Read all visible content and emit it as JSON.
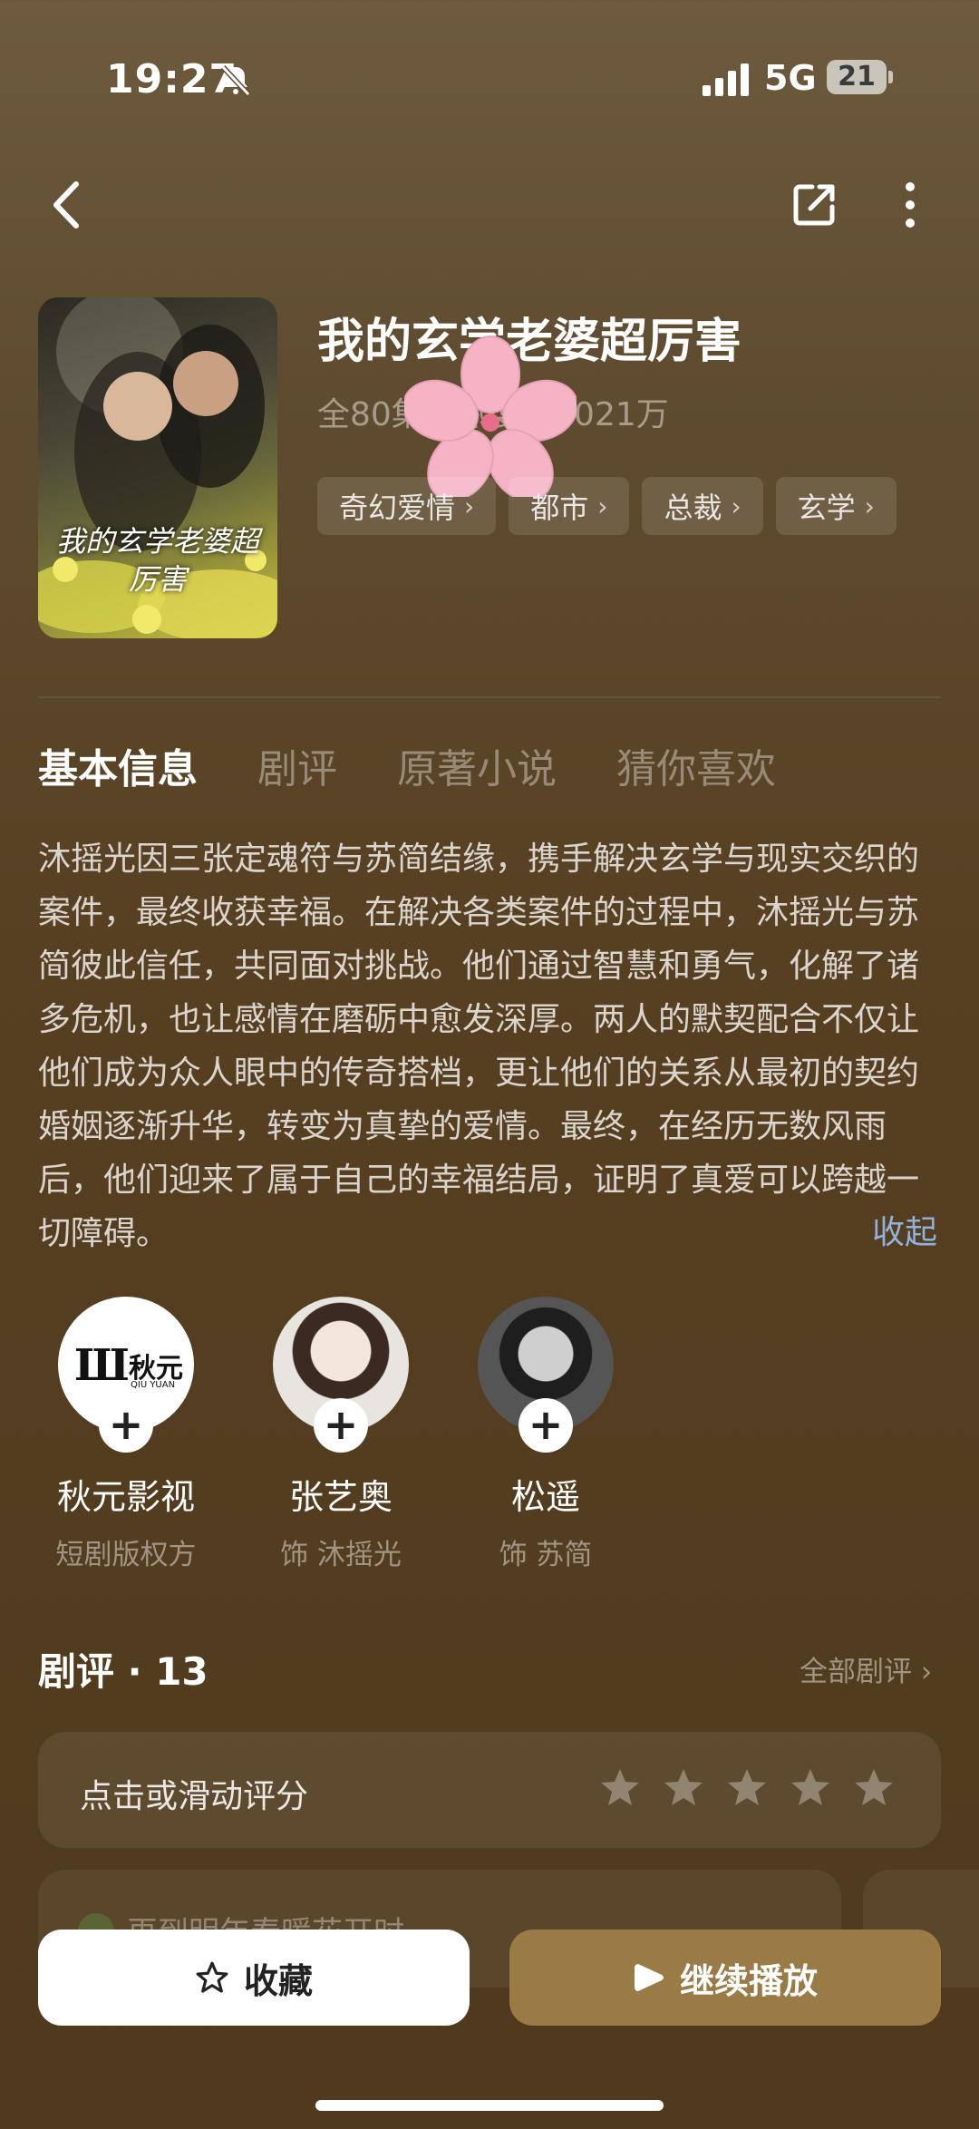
{
  "status_bar": {
    "time": "19:27",
    "network": "5G",
    "battery": "21"
  },
  "drama": {
    "title": "我的玄学老婆超厉害",
    "meta": "全80集 · 热度值4021万",
    "tags": [
      "奇幻爱情",
      "都市",
      "总裁",
      "玄学"
    ],
    "poster_text": "我的玄学老婆超厉害"
  },
  "tabs": [
    "基本信息",
    "剧评",
    "原著小说",
    "猜你喜欢"
  ],
  "synopsis": "沐摇光因三张定魂符与苏简结缘，携手解决玄学与现实交织的案件，最终收获幸福。在解决各类案件的过程中，沐摇光与苏简彼此信任，共同面对挑战。他们通过智慧和勇气，化解了诸多危机，也让感情在磨砺中愈发深厚。两人的默契配合不仅让他们成为众人眼中的传奇搭档，更让他们的关系从最初的契约婚姻逐渐升华，转变为真挚的爱情。最终，在经历无数风雨后，他们迎来了属于自己的幸福结局，证明了真爱可以跨越一切障碍。",
  "collapse_label": "收起",
  "cast": [
    {
      "name": "秋元影视",
      "role": "短剧版权方",
      "logo_text": "秋元",
      "logo_sub": "QIU YUAN"
    },
    {
      "name": "张艺奥",
      "role": "饰 沐摇光"
    },
    {
      "name": "松遥",
      "role": "饰 苏简"
    }
  ],
  "reviews": {
    "title": "剧评 · 13",
    "all_label": "全部剧评",
    "rate_prompt": "点击或滑动评分",
    "first_review_user": "再到明年春暖花开时"
  },
  "actions": {
    "favorite": "收藏",
    "play": "继续播放"
  },
  "colors": {
    "accent": "#9a7a45",
    "link": "#8fb3dd"
  }
}
